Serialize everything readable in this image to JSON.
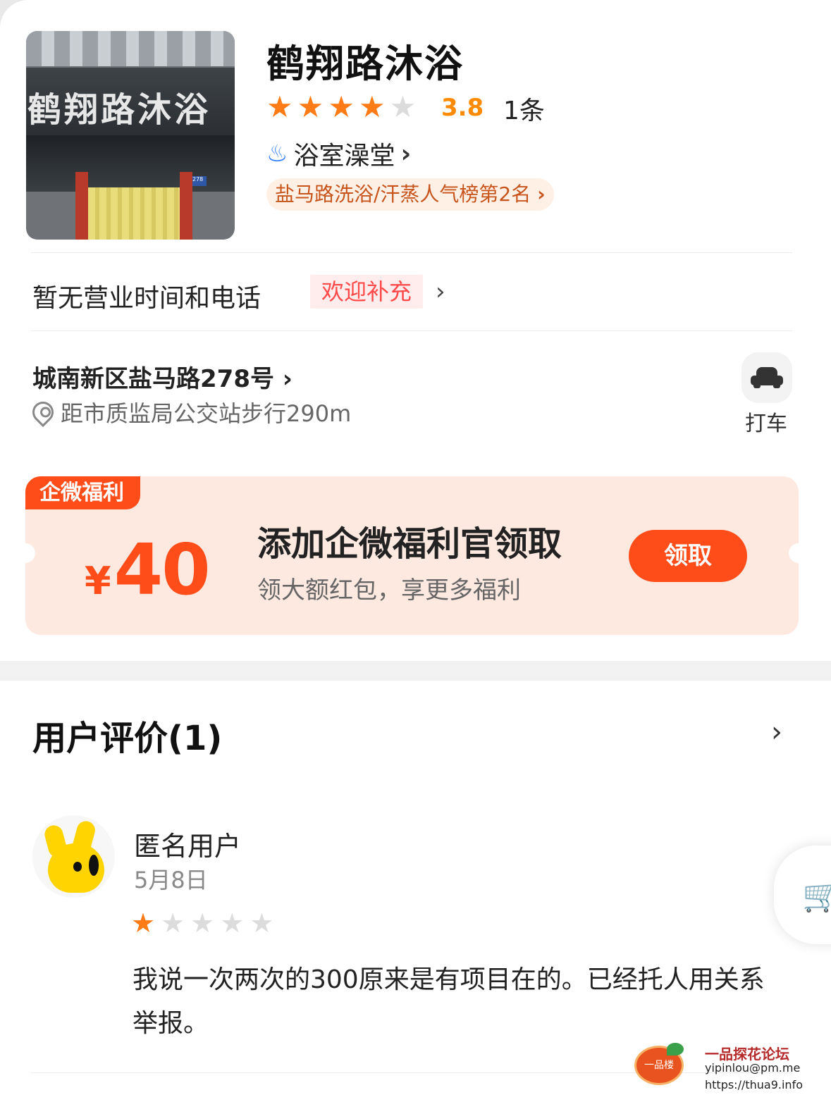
{
  "shop": {
    "name": "鹤翔路沐浴",
    "photo_sign": "鹤翔路沐浴",
    "rating": 3.8,
    "rating_text": "3.8",
    "stars": [
      "on",
      "on",
      "on",
      "on",
      "off"
    ],
    "review_count": "1条",
    "category": "浴室澡堂",
    "rank_badge": "盐马路洗浴/汗蒸人气榜第2名",
    "photo_plate": "278"
  },
  "info": {
    "hours_text": "暂无营业时间和电话",
    "welcome_label": "欢迎补充",
    "address": "城南新区盐马路278号",
    "distance": "距市质监局公交站步行290m",
    "taxi_label": "打车"
  },
  "coupon": {
    "tag": "企微福利",
    "currency": "¥",
    "amount": "40",
    "title": "添加企微福利官领取",
    "subtitle": "领大额红包，享更多福利",
    "button": "领取"
  },
  "reviews": {
    "header": "用户评价(1)",
    "items": [
      {
        "user": "匿名用户",
        "date": "5月8日",
        "stars": [
          "on",
          "off",
          "off",
          "off",
          "off"
        ],
        "text": "我说一次两次的300原来是有项目在的。已经托人用关系举报。"
      }
    ]
  },
  "icons": {
    "chevron": "›",
    "star": "★",
    "hot_spring": "♨",
    "cart": "🛒"
  },
  "colors": {
    "accent_orange": "#ff4d1a",
    "star_on": "#ff7b16",
    "star_off": "#dcdcdc",
    "rating_text": "#ff8a00"
  },
  "watermark": {
    "logo_text": "一品楼",
    "title": "一品探花论坛",
    "email": "yipinlou@pm.me",
    "url": "https://thua9.info"
  }
}
